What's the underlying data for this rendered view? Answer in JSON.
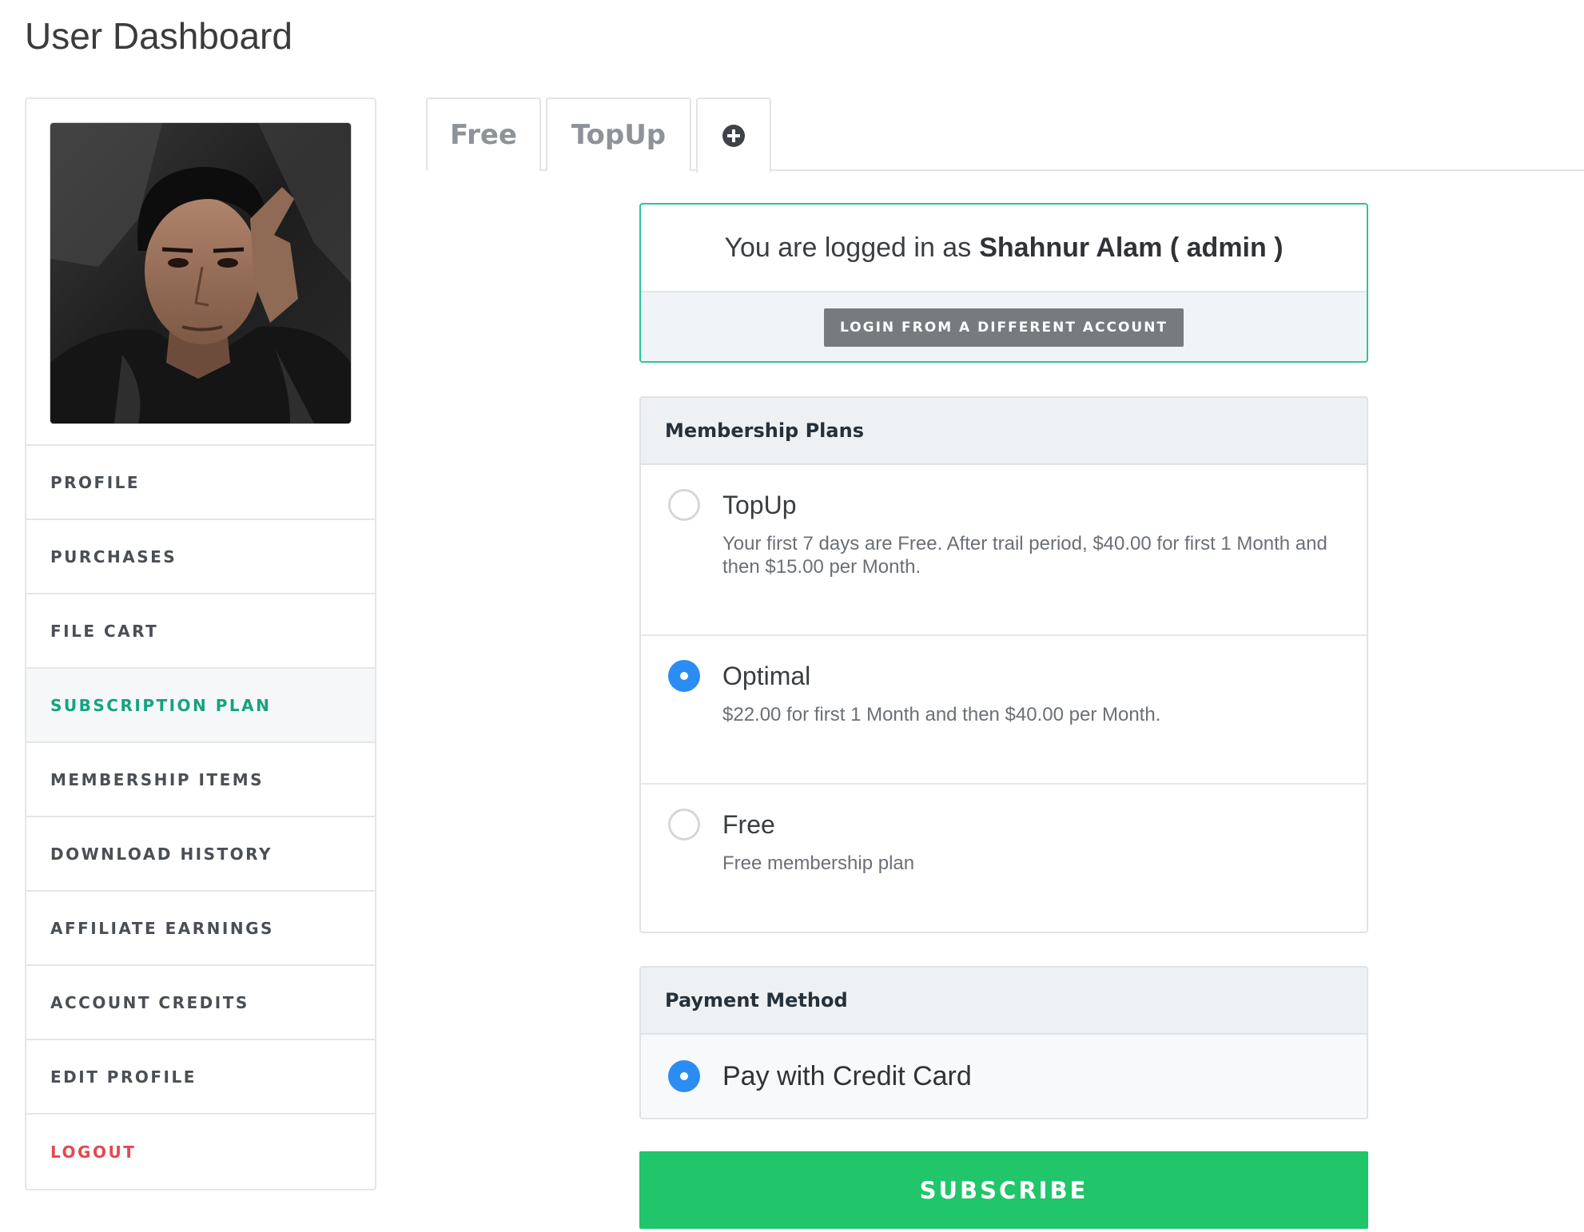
{
  "page": {
    "title": "User Dashboard"
  },
  "sidebar": {
    "items": [
      {
        "label": "PROFILE"
      },
      {
        "label": "PURCHASES"
      },
      {
        "label": "FILE CART"
      },
      {
        "label": "SUBSCRIPTION PLAN",
        "active": true
      },
      {
        "label": "MEMBERSHIP ITEMS"
      },
      {
        "label": "DOWNLOAD HISTORY"
      },
      {
        "label": "AFFILIATE EARNINGS"
      },
      {
        "label": "ACCOUNT CREDITS"
      },
      {
        "label": "EDIT PROFILE"
      },
      {
        "label": "LOGOUT"
      }
    ]
  },
  "tabs": [
    {
      "label": "Free"
    },
    {
      "label": "TopUp"
    },
    {
      "icon": "plus-circle-icon"
    }
  ],
  "login": {
    "prefix": "You are logged in as",
    "user": "Shahnur Alam ( admin )",
    "switch_label": "LOGIN FROM A DIFFERENT ACCOUNT"
  },
  "plans": {
    "title": "Membership Plans",
    "items": [
      {
        "name": "TopUp",
        "desc": "Your first 7 days are Free. After trail period, $40.00 for first 1 Month and then $15.00 per Month.",
        "selected": false
      },
      {
        "name": "Optimal",
        "desc": "$22.00 for first 1 Month and then $40.00 per Month.",
        "selected": true
      },
      {
        "name": "Free",
        "desc": "Free membership plan",
        "selected": false
      }
    ]
  },
  "payment": {
    "title": "Payment Method",
    "option": "Pay with Credit Card"
  },
  "subscribe_label": "SUBSCRIBE",
  "colors": {
    "accent": "#14a37f",
    "logout": "#e5484d",
    "radio_selected": "#2b8df3",
    "subscribe": "#21c56a",
    "login_border": "#2cc39a"
  }
}
